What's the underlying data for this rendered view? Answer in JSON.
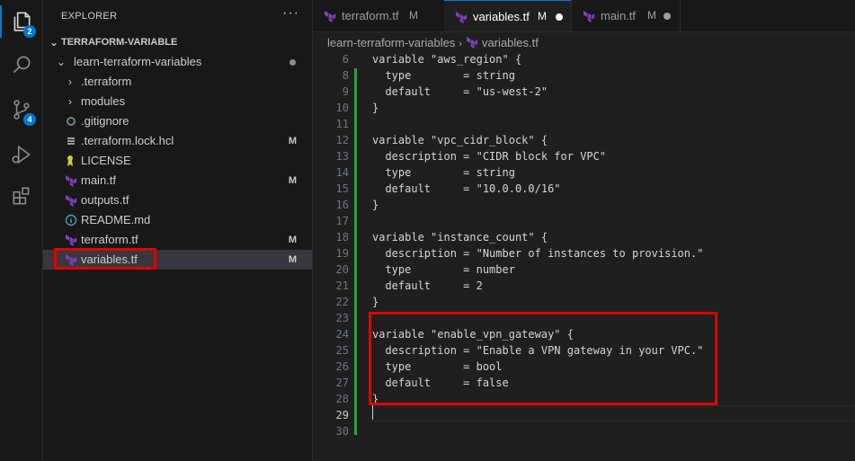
{
  "activity_bar": {
    "items": [
      {
        "icon": "files-icon",
        "badge": "2"
      },
      {
        "icon": "search-icon",
        "badge": ""
      },
      {
        "icon": "source-control-icon",
        "badge": "4"
      },
      {
        "icon": "run-debug-icon",
        "badge": ""
      },
      {
        "icon": "extensions-icon",
        "badge": ""
      }
    ]
  },
  "sidebar": {
    "title": "EXPLORER",
    "more": "···",
    "root": "TERRAFORM-VARIABLE",
    "folder": "learn-terraform-variables",
    "items": [
      {
        "name": ".terraform",
        "status": ""
      },
      {
        "name": "modules",
        "status": ""
      },
      {
        "name": ".gitignore",
        "status": ""
      },
      {
        "name": ".terraform.lock.hcl",
        "status": "M"
      },
      {
        "name": "LICENSE",
        "status": ""
      },
      {
        "name": "main.tf",
        "status": "M"
      },
      {
        "name": "outputs.tf",
        "status": ""
      },
      {
        "name": "README.md",
        "status": ""
      },
      {
        "name": "terraform.tf",
        "status": "M"
      },
      {
        "name": "variables.tf",
        "status": "M"
      }
    ]
  },
  "tabs": [
    {
      "label": "terraform.tf",
      "modified": "M"
    },
    {
      "label": "variables.tf",
      "modified": "M"
    },
    {
      "label": "main.tf",
      "modified": "M"
    }
  ],
  "breadcrumb": {
    "folder": "learn-terraform-variables",
    "file": "variables.tf"
  },
  "editor": {
    "lines": [
      {
        "n": "6",
        "text": "variable \"aws_region\" {"
      },
      {
        "n": "8",
        "text": "  type        = string"
      },
      {
        "n": "9",
        "text": "  default     = \"us-west-2\""
      },
      {
        "n": "10",
        "text": "}"
      },
      {
        "n": "11",
        "text": ""
      },
      {
        "n": "12",
        "text": "variable \"vpc_cidr_block\" {"
      },
      {
        "n": "13",
        "text": "  description = \"CIDR block for VPC\""
      },
      {
        "n": "14",
        "text": "  type        = string"
      },
      {
        "n": "15",
        "text": "  default     = \"10.0.0.0/16\""
      },
      {
        "n": "16",
        "text": "}"
      },
      {
        "n": "17",
        "text": ""
      },
      {
        "n": "18",
        "text": "variable \"instance_count\" {"
      },
      {
        "n": "19",
        "text": "  description = \"Number of instances to provision.\""
      },
      {
        "n": "20",
        "text": "  type        = number"
      },
      {
        "n": "21",
        "text": "  default     = 2"
      },
      {
        "n": "22",
        "text": "}"
      },
      {
        "n": "23",
        "text": ""
      },
      {
        "n": "24",
        "text": "variable \"enable_vpn_gateway\" {"
      },
      {
        "n": "25",
        "text": "  description = \"Enable a VPN gateway in your VPC.\""
      },
      {
        "n": "26",
        "text": "  type        = bool"
      },
      {
        "n": "27",
        "text": "  default     = false"
      },
      {
        "n": "28",
        "text": "}"
      },
      {
        "n": "29",
        "text": ""
      },
      {
        "n": "30",
        "text": ""
      }
    ]
  },
  "colors": {
    "accent": "#0078d4",
    "highlight_box": "#e00000",
    "git_added": "#2ea043",
    "terraform_purple": "#7b42bc"
  }
}
